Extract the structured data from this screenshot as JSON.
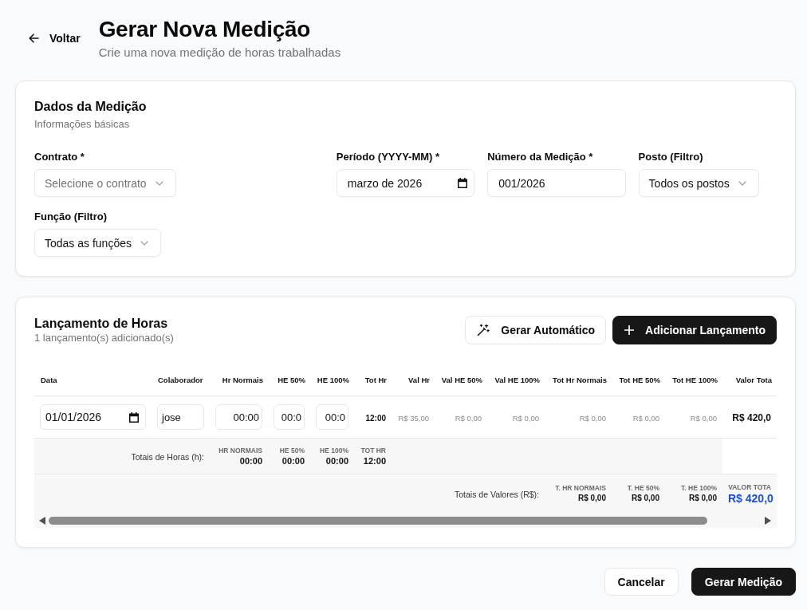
{
  "header": {
    "back_label": "Voltar",
    "title": "Gerar Nova Medição",
    "subtitle": "Crie uma nova medição de horas trabalhadas"
  },
  "details_card": {
    "title": "Dados da Medição",
    "subtitle": "Informações básicas",
    "fields": [
      {
        "kind": "select",
        "label": "Contrato *",
        "placeholder": "Selecione o contrato"
      },
      {
        "kind": "month",
        "label": "Período (YYYY-MM) *",
        "value": "marzo de 2026"
      },
      {
        "kind": "text",
        "label": "Número da Medição *",
        "value": "001/2026"
      },
      {
        "kind": "select",
        "label": "Posto (Filtro)",
        "value": "Todos os postos"
      },
      {
        "kind": "select",
        "label": "Função (Filtro)",
        "value": "Todas as funções"
      }
    ]
  },
  "hours_card": {
    "title": "Lançamento de Horas",
    "subtitle": "1 lançamento(s) adicionado(s)",
    "buttons": [
      {
        "kind": "secondary",
        "label": "Gerar Automático"
      },
      {
        "kind": "primary",
        "label": "Adicionar Lançamento"
      }
    ],
    "table": {
      "columns": [
        "Data",
        "Colaborador",
        "Hr Normais",
        "HE 50%",
        "HE 100%",
        "Tot Hr",
        "Val Hr",
        "Val HE 50%",
        "Val HE 100%",
        "Tot Hr Normais",
        "Tot HE 50%",
        "Tot HE 100%",
        "Valor Tota"
      ],
      "rows": [
        {
          "cells": [
            {
              "kind": "date",
              "value": "01/01/2026"
            },
            {
              "kind": "text",
              "value": "jose"
            },
            {
              "kind": "time",
              "value": "00:00"
            },
            {
              "kind": "time",
              "value": "00:0"
            },
            {
              "kind": "time",
              "value": "00:0"
            },
            {
              "kind": "strong",
              "value": "12:00"
            },
            {
              "kind": "muted",
              "value": "R$ 35,00"
            },
            {
              "kind": "muted",
              "value": "R$ 0,00"
            },
            {
              "kind": "muted",
              "value": "R$ 0,00"
            },
            {
              "kind": "muted",
              "value": "R$ 0,00"
            },
            {
              "kind": "muted",
              "value": "R$ 0,00"
            },
            {
              "kind": "muted",
              "value": "R$ 0,00"
            },
            {
              "kind": "total",
              "value": "R$ 420,0"
            }
          ]
        }
      ],
      "hour_totals": {
        "label": "Totais de Horas (h):",
        "items": [
          {
            "label": "HR NORMAIS",
            "value": "00:00"
          },
          {
            "label": "HE 50%",
            "value": "00:00"
          },
          {
            "label": "HE 100%",
            "value": "00:00"
          },
          {
            "label": "TOT HR",
            "value": "12:00"
          }
        ]
      },
      "value_totals": {
        "label": "Totais de Valores (R$):",
        "items": [
          {
            "kind": "normal",
            "label": "T. HR NORMAIS",
            "value": "R$ 0,00"
          },
          {
            "kind": "normal",
            "label": "T. HE 50%",
            "value": "R$ 0,00"
          },
          {
            "kind": "normal",
            "label": "T. HE 100%",
            "value": "R$ 0,00"
          },
          {
            "kind": "grand",
            "label": "VALOR TOTA",
            "value": "R$ 420,0"
          }
        ]
      }
    }
  },
  "footer": {
    "buttons": [
      {
        "kind": "secondary",
        "label": "Cancelar"
      },
      {
        "kind": "primary",
        "label": "Gerar Medição"
      }
    ]
  }
}
